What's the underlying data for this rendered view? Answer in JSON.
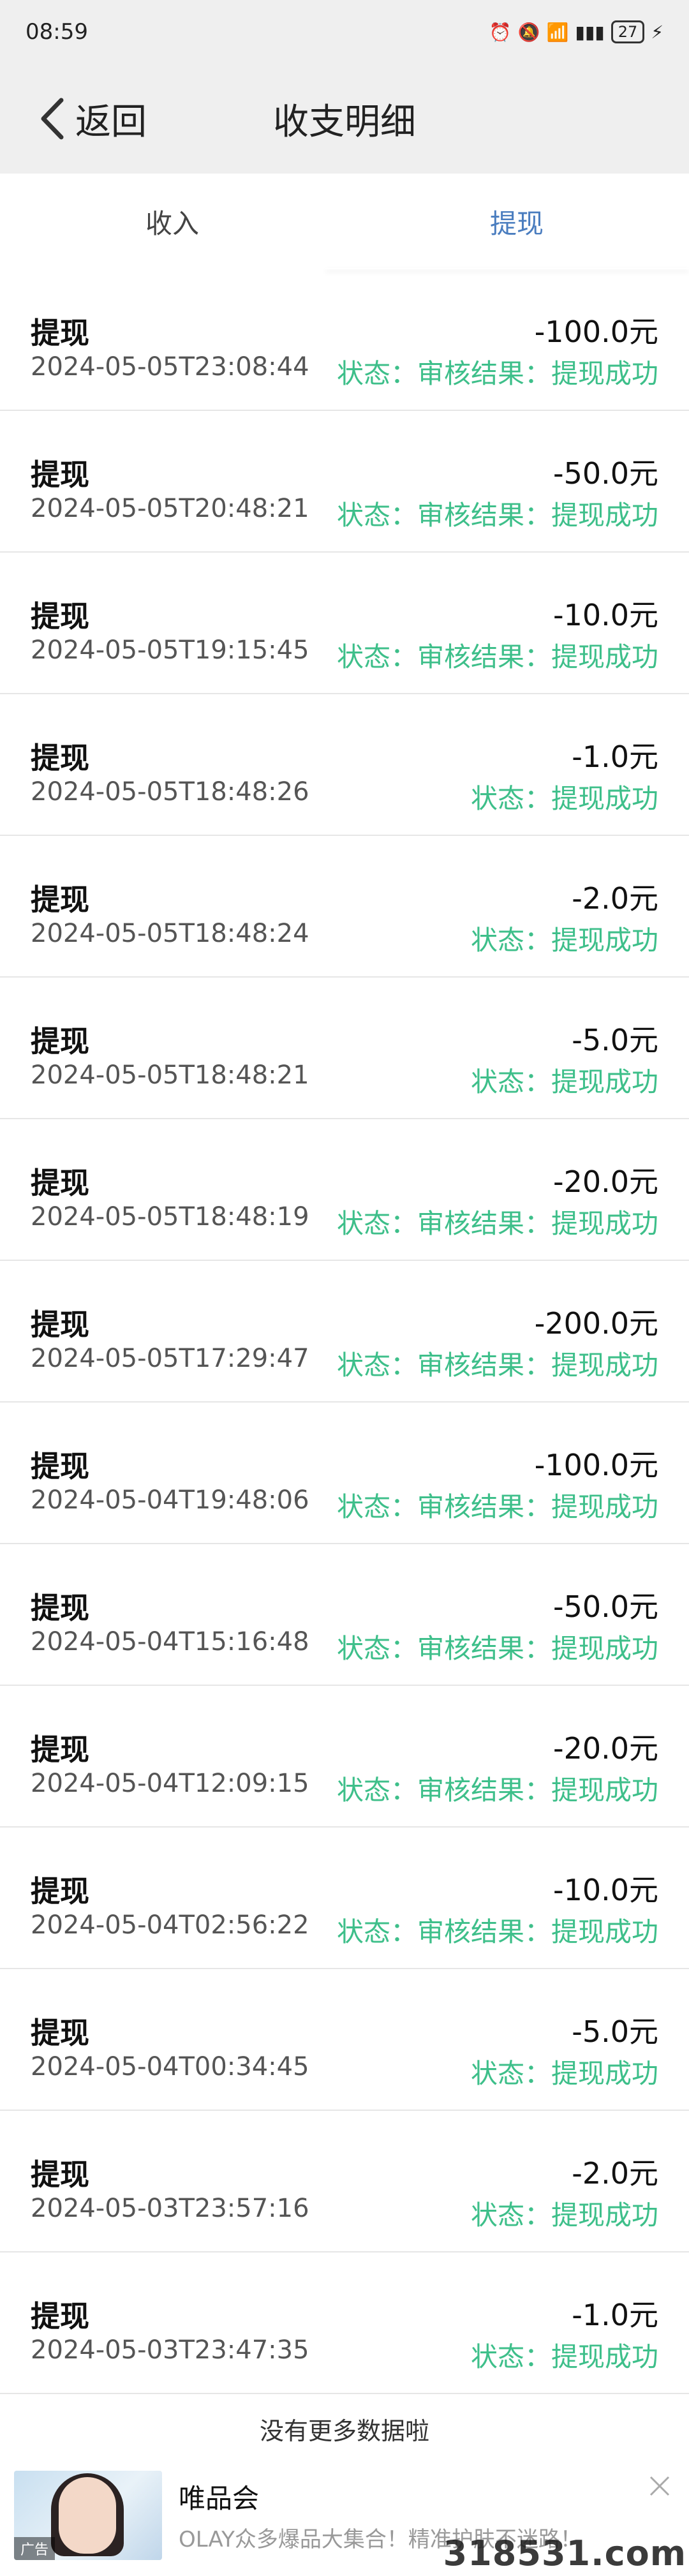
{
  "status_bar": {
    "time": "08:59",
    "battery": "27"
  },
  "header": {
    "back_label": "返回",
    "title": "收支明细"
  },
  "tabs": [
    {
      "label": "收入",
      "active": false
    },
    {
      "label": "提现",
      "active": true
    }
  ],
  "records": [
    {
      "type": "提现",
      "amount": "-100.0元",
      "date": "2024-05-05T23:08:44",
      "status": "状态：审核结果：提现成功"
    },
    {
      "type": "提现",
      "amount": "-50.0元",
      "date": "2024-05-05T20:48:21",
      "status": "状态：审核结果：提现成功"
    },
    {
      "type": "提现",
      "amount": "-10.0元",
      "date": "2024-05-05T19:15:45",
      "status": "状态：审核结果：提现成功"
    },
    {
      "type": "提现",
      "amount": "-1.0元",
      "date": "2024-05-05T18:48:26",
      "status": "状态：提现成功"
    },
    {
      "type": "提现",
      "amount": "-2.0元",
      "date": "2024-05-05T18:48:24",
      "status": "状态：提现成功"
    },
    {
      "type": "提现",
      "amount": "-5.0元",
      "date": "2024-05-05T18:48:21",
      "status": "状态：提现成功"
    },
    {
      "type": "提现",
      "amount": "-20.0元",
      "date": "2024-05-05T18:48:19",
      "status": "状态：审核结果：提现成功"
    },
    {
      "type": "提现",
      "amount": "-200.0元",
      "date": "2024-05-05T17:29:47",
      "status": "状态：审核结果：提现成功"
    },
    {
      "type": "提现",
      "amount": "-100.0元",
      "date": "2024-05-04T19:48:06",
      "status": "状态：审核结果：提现成功"
    },
    {
      "type": "提现",
      "amount": "-50.0元",
      "date": "2024-05-04T15:16:48",
      "status": "状态：审核结果：提现成功"
    },
    {
      "type": "提现",
      "amount": "-20.0元",
      "date": "2024-05-04T12:09:15",
      "status": "状态：审核结果：提现成功"
    },
    {
      "type": "提现",
      "amount": "-10.0元",
      "date": "2024-05-04T02:56:22",
      "status": "状态：审核结果：提现成功"
    },
    {
      "type": "提现",
      "amount": "-5.0元",
      "date": "2024-05-04T00:34:45",
      "status": "状态：提现成功"
    },
    {
      "type": "提现",
      "amount": "-2.0元",
      "date": "2024-05-03T23:57:16",
      "status": "状态：提现成功"
    },
    {
      "type": "提现",
      "amount": "-1.0元",
      "date": "2024-05-03T23:47:35",
      "status": "状态：提现成功"
    }
  ],
  "end_note": "没有更多数据啦",
  "ad": {
    "badge": "广告",
    "title": "唯品会",
    "description": "OLAY众多爆品大集合！精准护肤不迷路！"
  },
  "watermark": "318531.com",
  "colors": {
    "accent_tab": "#4a7dbf",
    "status_green": "#3ebf8a",
    "header_bg": "#efefef"
  }
}
